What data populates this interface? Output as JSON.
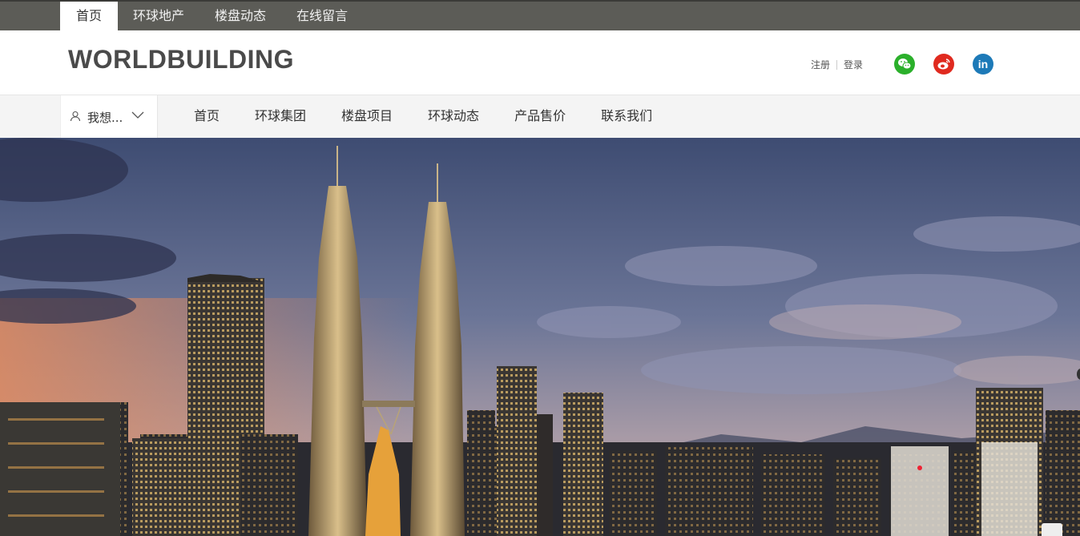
{
  "topnav": {
    "items": [
      {
        "label": "首页",
        "active": true
      },
      {
        "label": "环球地产",
        "active": false
      },
      {
        "label": "楼盘动态",
        "active": false
      },
      {
        "label": "在线留言",
        "active": false
      }
    ]
  },
  "header": {
    "logo": "WORLDBUILDING",
    "register": "注册",
    "login": "登录",
    "social": [
      "wechat-icon",
      "weibo-icon",
      "linkedin-icon"
    ],
    "linkedin_text": "in"
  },
  "mainnav": {
    "want_label": "我想...",
    "items": [
      "首页",
      "环球集团",
      "楼盘项目",
      "环球动态",
      "产品售价",
      "联系我们"
    ]
  },
  "colors": {
    "topbar": "#5c5c57",
    "wechat": "#2bb02b",
    "weibo": "#e02a1f",
    "linkedin": "#1d7ab8"
  },
  "hero": {
    "image": "city-skyline-twin-towers-dusk"
  }
}
